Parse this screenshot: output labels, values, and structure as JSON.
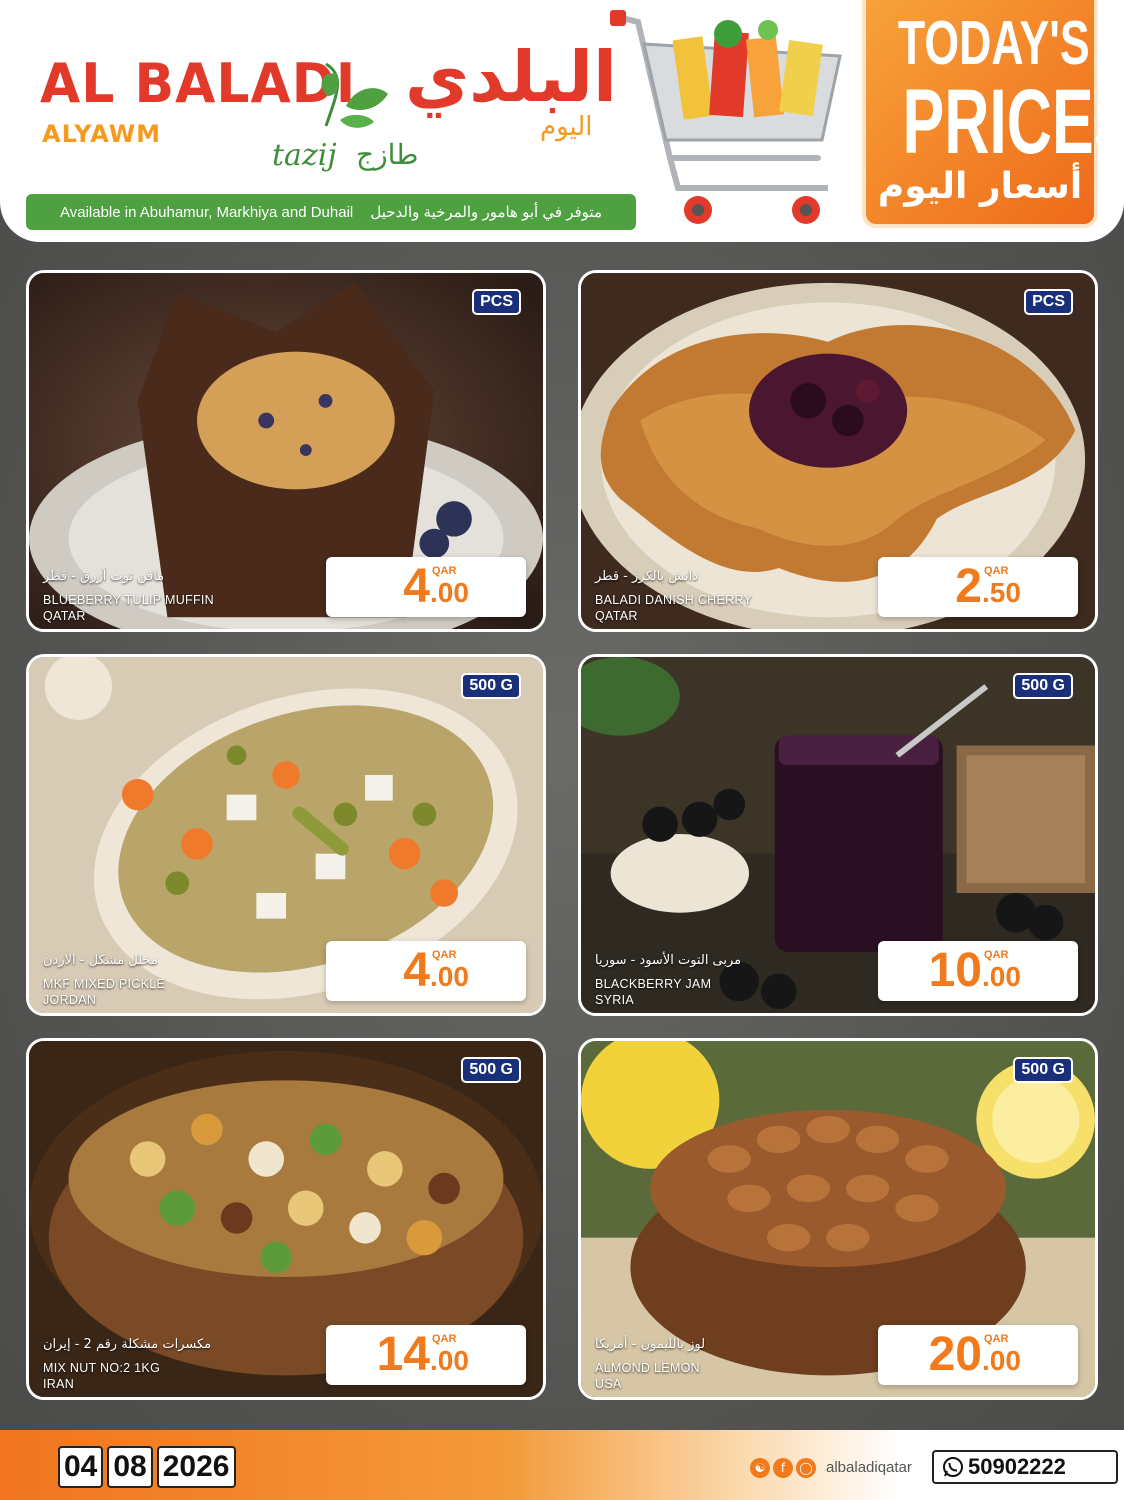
{
  "header": {
    "brand_en": "AL BALADI",
    "brand_en_sub": "ALYAWM",
    "brand_ar": "البلدي",
    "brand_ar_sub": "اليوم",
    "tazij_en": "tazij",
    "tazij_ar": "طازج",
    "availability_en": "Available in Abuhamur, Markhiya and Duhail",
    "availability_ar": "متوفر في أبو هامور والمرخية والدحيل",
    "promo_line1": "TODAY'S",
    "promo_line2": "PRICES",
    "promo_ar": "أسعار اليوم"
  },
  "products": [
    {
      "unit": "PCS",
      "name_ar": "مافن توت أزرق - قطر",
      "name_en": "BLUEBERRY TULIP MUFFIN",
      "origin": "QATAR",
      "currency": "QAR",
      "price_int": "4",
      "price_dec": ".00"
    },
    {
      "unit": "PCS",
      "name_ar": "دانش بالكرز - قطر",
      "name_en": "BALADI DANISH CHERRY",
      "origin": "QATAR",
      "currency": "QAR",
      "price_int": "2",
      "price_dec": ".50"
    },
    {
      "unit": "500 G",
      "name_ar": "مخلل مشكل - الاردن",
      "name_en": "MKF MIXED PICKLE",
      "origin": "JORDAN",
      "currency": "QAR",
      "price_int": "4",
      "price_dec": ".00"
    },
    {
      "unit": "500 G",
      "name_ar": "مربى التوت الأسود - سوريا",
      "name_en": "BLACKBERRY JAM",
      "origin": "SYRIA",
      "currency": "QAR",
      "price_int": "10",
      "price_dec": ".00"
    },
    {
      "unit": "500 G",
      "name_ar": "مكسرات مشكلة رقم 2 - إيران",
      "name_en": "MIX NUT NO:2 1KG",
      "origin": "IRAN",
      "currency": "QAR",
      "price_int": "14",
      "price_dec": ".00"
    },
    {
      "unit": "500 G",
      "name_ar": "لوز بالليمون - أمريكا",
      "name_en": "ALMOND LEMON",
      "origin": "USA",
      "currency": "QAR",
      "price_int": "20",
      "price_dec": ".00"
    }
  ],
  "footer": {
    "date_day": "04",
    "date_month": "08",
    "date_year": "2026",
    "social_handle": "albaladiqatar",
    "phone": "50902222"
  },
  "colors": {
    "brand_red": "#e23a2a",
    "brand_orange": "#f07a1c",
    "brand_green": "#4fa041",
    "badge_navy": "#1a2f7a"
  }
}
